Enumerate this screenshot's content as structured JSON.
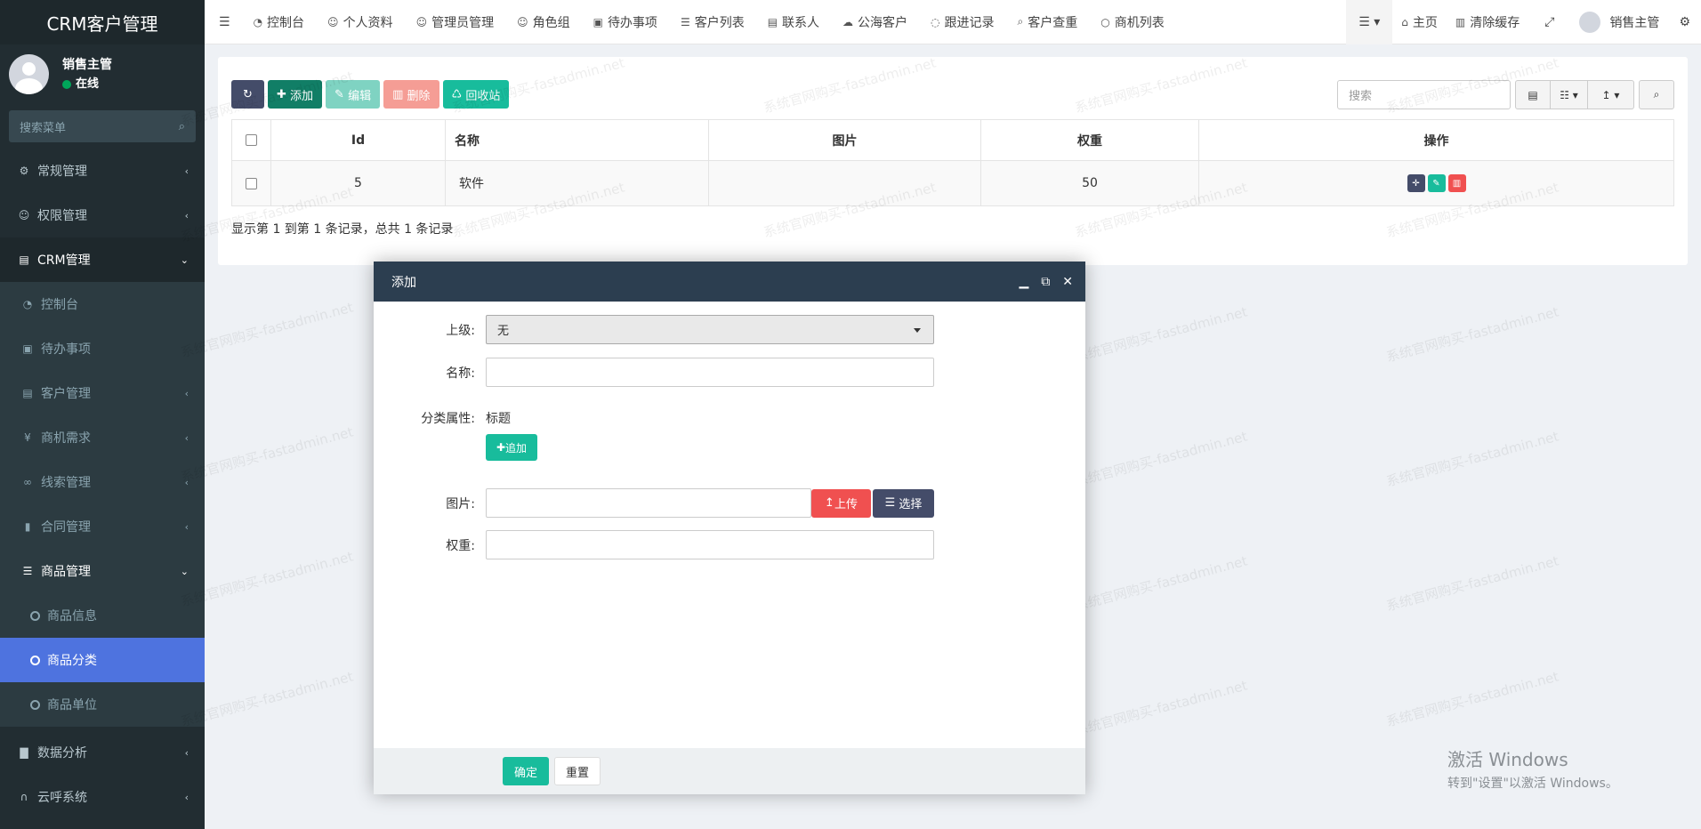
{
  "sidebar": {
    "title": "CRM客户管理",
    "user": {
      "name": "销售主管",
      "status": "在线"
    },
    "search_placeholder": "搜索菜单",
    "menu": [
      {
        "label": "常规管理"
      },
      {
        "label": "权限管理"
      },
      {
        "label": "CRM管理"
      },
      {
        "label": "控制台"
      },
      {
        "label": "待办事项"
      },
      {
        "label": "客户管理"
      },
      {
        "label": "商机需求"
      },
      {
        "label": "线索管理"
      },
      {
        "label": "合同管理"
      },
      {
        "label": "商品管理"
      },
      {
        "label": "商品信息"
      },
      {
        "label": "商品分类"
      },
      {
        "label": "商品单位"
      },
      {
        "label": "数据分析"
      },
      {
        "label": "云呼系统"
      }
    ]
  },
  "topbar": {
    "tabs": [
      "控制台",
      "个人资料",
      "管理员管理",
      "角色组",
      "待办事项",
      "客户列表",
      "联系人",
      "公海客户",
      "跟进记录",
      "客户查重",
      "商机列表"
    ],
    "home": "主页",
    "clear_cache": "清除缓存",
    "user": "销售主管"
  },
  "toolbar": {
    "add": "添加",
    "edit": "编辑",
    "delete": "删除",
    "recycle": "回收站",
    "search_placeholder": "搜索"
  },
  "table": {
    "headers": [
      "Id",
      "名称",
      "图片",
      "权重",
      "操作"
    ],
    "rows": [
      {
        "id": "5",
        "name": "软件",
        "image": "",
        "weight": "50"
      }
    ],
    "pagination": "显示第 1 到第 1 条记录，总共 1 条记录"
  },
  "modal": {
    "title": "添加",
    "fields": {
      "parent_label": "上级:",
      "parent_value": "无",
      "name_label": "名称:",
      "attr_label": "分类属性:",
      "attr_title": "标题",
      "attr_add": "追加",
      "image_label": "图片:",
      "upload": "上传",
      "choose": "选择",
      "weight_label": "权重:"
    },
    "confirm": "确定",
    "reset": "重置"
  },
  "watermark": "系统官网购买-fastadmin.net",
  "windows": {
    "line1": "激活 Windows",
    "line2": "转到\"设置\"以激活 Windows。"
  },
  "colors": {
    "accent": "#4e73df",
    "green": "#18bc9c",
    "red": "#f05050",
    "dark": "#444c69"
  }
}
